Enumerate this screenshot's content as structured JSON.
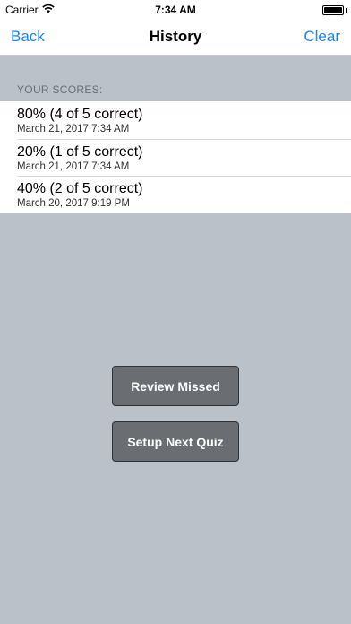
{
  "status_bar": {
    "carrier": "Carrier",
    "time": "7:34 AM"
  },
  "nav": {
    "back_label": "Back",
    "title": "History",
    "clear_label": "Clear"
  },
  "scores_section": {
    "header": "YOUR SCORES:",
    "items": [
      {
        "score": "80% (4 of 5 correct)",
        "date": "March 21, 2017  7:34 AM"
      },
      {
        "score": "20% (1 of 5 correct)",
        "date": "March 21, 2017  7:34 AM"
      },
      {
        "score": "40% (2 of 5 correct)",
        "date": "March 20, 2017  9:19 PM"
      }
    ]
  },
  "actions": {
    "review_label": "Review Missed",
    "setup_label": "Setup Next Quiz"
  },
  "colors": {
    "accent": "#1a83f6",
    "background": "#bac1c9",
    "button": "#6a6e73"
  }
}
